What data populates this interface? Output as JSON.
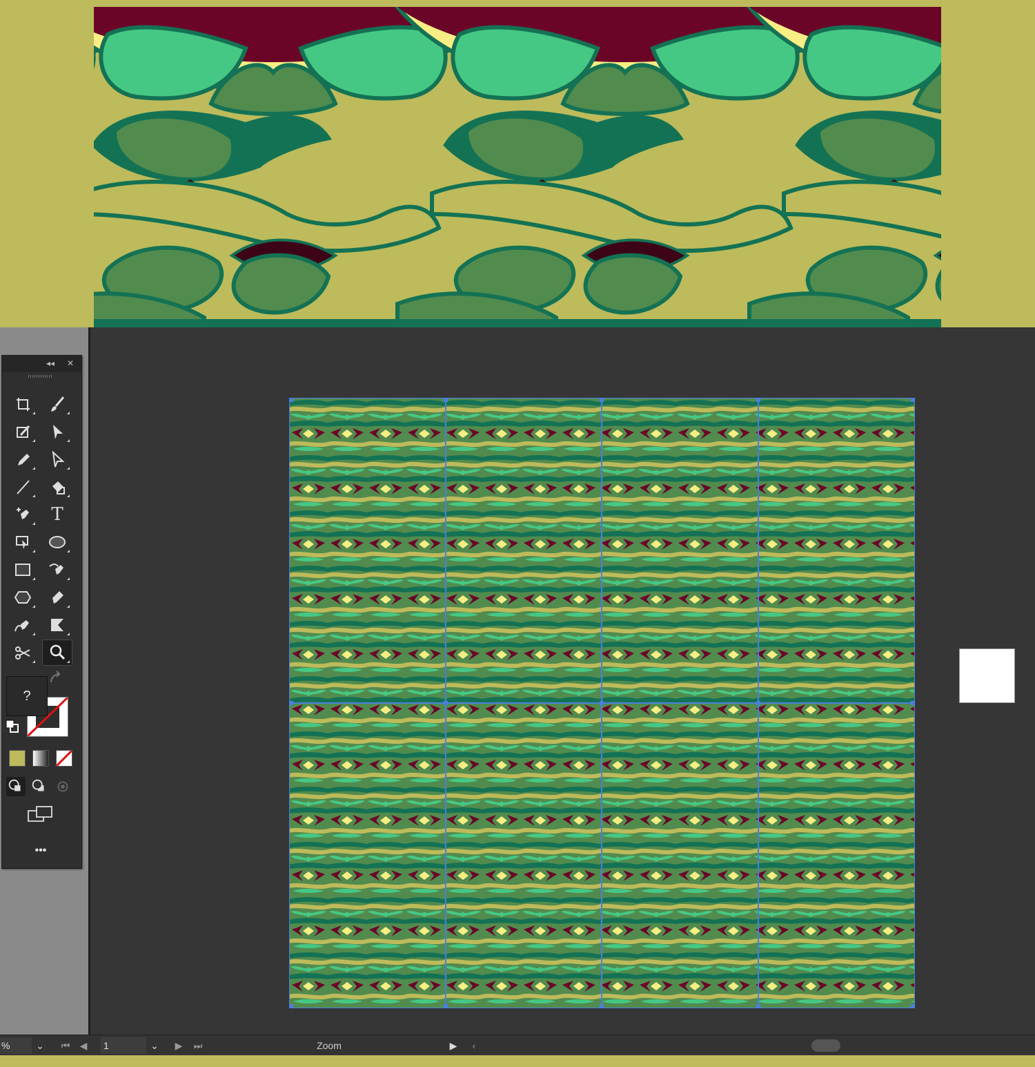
{
  "window": {
    "background": "#bdbb5b",
    "workspace_color": "#363636"
  },
  "pattern_colors": {
    "maroon": "#6b0528",
    "dark_teal": "#147254",
    "mint": "#46c885",
    "olive_green": "#528b4e",
    "khaki": "#bdbb5b",
    "pale_yellow": "#f8ee84",
    "darkest": "#3d0418"
  },
  "toolbox": {
    "collapse_icon": "double-chevron-left-icon",
    "close_icon": "close-icon",
    "tools": [
      {
        "name": "artboard-tool-icon"
      },
      {
        "name": "paintbrush-tool-icon"
      },
      {
        "name": "shaper-tool-icon"
      },
      {
        "name": "direct-selection-tool-icon"
      },
      {
        "name": "pencil-tool-icon"
      },
      {
        "name": "group-selection-tool-icon"
      },
      {
        "name": "line-segment-tool-icon"
      },
      {
        "name": "live-paint-bucket-icon"
      },
      {
        "name": "add-anchor-point-tool-icon"
      },
      {
        "name": "type-tool-icon"
      },
      {
        "name": "free-transform-tool-icon"
      },
      {
        "name": "ellipse-tool-icon"
      },
      {
        "name": "rectangle-tool-icon"
      },
      {
        "name": "curvature-tool-icon"
      },
      {
        "name": "polygon-tool-icon"
      },
      {
        "name": "pen-tool-icon"
      },
      {
        "name": "anchor-point-tool-icon"
      },
      {
        "name": "gradient-tool-icon"
      },
      {
        "name": "scissors-tool-icon"
      },
      {
        "name": "zoom-tool-icon"
      }
    ],
    "type_glyph": "T",
    "fill_label": "?",
    "fill_color": "#bdbb5b",
    "more_label": "•••"
  },
  "statusbar": {
    "zoom_value": "%",
    "artboard_number": "1",
    "status_label": "Zoom"
  }
}
